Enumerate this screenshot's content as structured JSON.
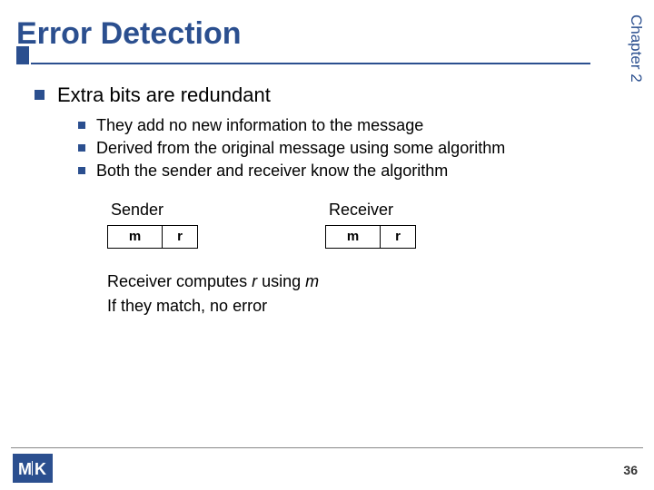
{
  "chapter_label": "Chapter 2",
  "title": "Error Detection",
  "bullet1": "Extra bits are redundant",
  "sub": {
    "a": "They add no new information to the message",
    "b": "Derived from the original message using some algorithm",
    "c": "Both the sender and receiver know the algorithm"
  },
  "diagram": {
    "sender_label": "Sender",
    "receiver_label": "Receiver",
    "m": "m",
    "r": "r"
  },
  "conclusion": {
    "line1_pre": "Receiver computes ",
    "line1_r": "r",
    "line1_mid": " using ",
    "line1_m": "m",
    "line2": "If they match, no error"
  },
  "logo_text": "MK",
  "page_number": "36"
}
